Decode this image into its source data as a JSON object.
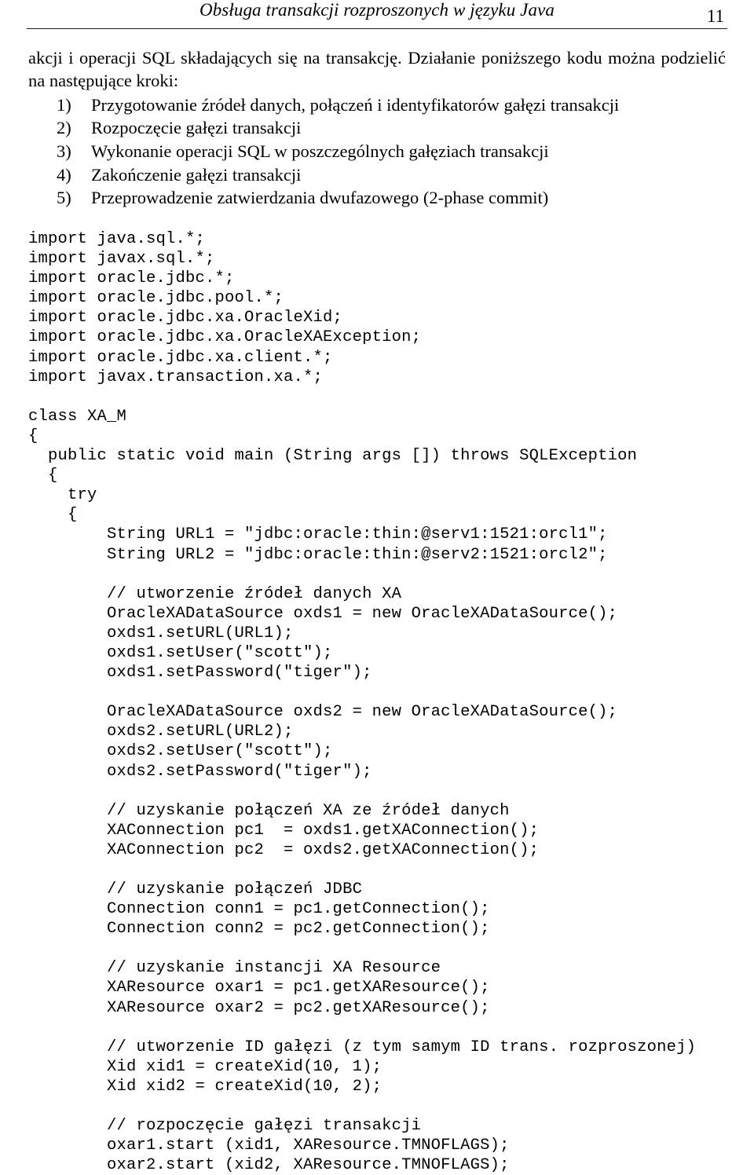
{
  "header": {
    "title": "Obsługa transakcji rozproszonych w języku Java",
    "page_number": "11"
  },
  "body": {
    "paragraph": "akcji i operacji SQL składających się na transakcję. Działanie poniższego kodu można podzielić na następujące kroki:",
    "steps": [
      {
        "number": "1)",
        "text": "Przygotowanie źródeł danych, połączeń i identyfikatorów gałęzi transakcji"
      },
      {
        "number": "2)",
        "text": "Rozpoczęcie gałęzi transakcji"
      },
      {
        "number": "3)",
        "text": "Wykonanie operacji SQL w poszczególnych gałęziach transakcji"
      },
      {
        "number": "4)",
        "text": "Zakończenie gałęzi transakcji"
      },
      {
        "number": "5)",
        "text": "Przeprowadzenie zatwierdzania dwufazowego (2-phase commit)"
      }
    ]
  },
  "code": {
    "language": "java",
    "lines": [
      "import java.sql.*;",
      "import javax.sql.*;",
      "import oracle.jdbc.*;",
      "import oracle.jdbc.pool.*;",
      "import oracle.jdbc.xa.OracleXid;",
      "import oracle.jdbc.xa.OracleXAException;",
      "import oracle.jdbc.xa.client.*;",
      "import javax.transaction.xa.*;",
      "",
      "class XA_M",
      "{",
      "  public static void main (String args []) throws SQLException",
      "  {",
      "    try",
      "    {",
      "        String URL1 = \"jdbc:oracle:thin:@serv1:1521:orcl1\";",
      "        String URL2 = \"jdbc:oracle:thin:@serv2:1521:orcl2\";",
      "",
      "        // utworzenie źródeł danych XA",
      "        OracleXADataSource oxds1 = new OracleXADataSource();",
      "        oxds1.setURL(URL1);",
      "        oxds1.setUser(\"scott\");",
      "        oxds1.setPassword(\"tiger\");",
      "",
      "        OracleXADataSource oxds2 = new OracleXADataSource();",
      "        oxds2.setURL(URL2);",
      "        oxds2.setUser(\"scott\");",
      "        oxds2.setPassword(\"tiger\");",
      "",
      "        // uzyskanie połączeń XA ze źródeł danych",
      "        XAConnection pc1  = oxds1.getXAConnection();",
      "        XAConnection pc2  = oxds2.getXAConnection();",
      "",
      "        // uzyskanie połączeń JDBC",
      "        Connection conn1 = pc1.getConnection();",
      "        Connection conn2 = pc2.getConnection();",
      "",
      "        // uzyskanie instancji XA Resource",
      "        XAResource oxar1 = pc1.getXAResource();",
      "        XAResource oxar2 = pc2.getXAResource();",
      "",
      "        // utworzenie ID gałęzi (z tym samym ID trans. rozproszonej)",
      "        Xid xid1 = createXid(10, 1);",
      "        Xid xid2 = createXid(10, 2);",
      "",
      "        // rozpoczęcie gałęzi transakcji",
      "        oxar1.start (xid1, XAResource.TMNOFLAGS);",
      "        oxar2.start (xid2, XAResource.TMNOFLAGS);"
    ]
  }
}
